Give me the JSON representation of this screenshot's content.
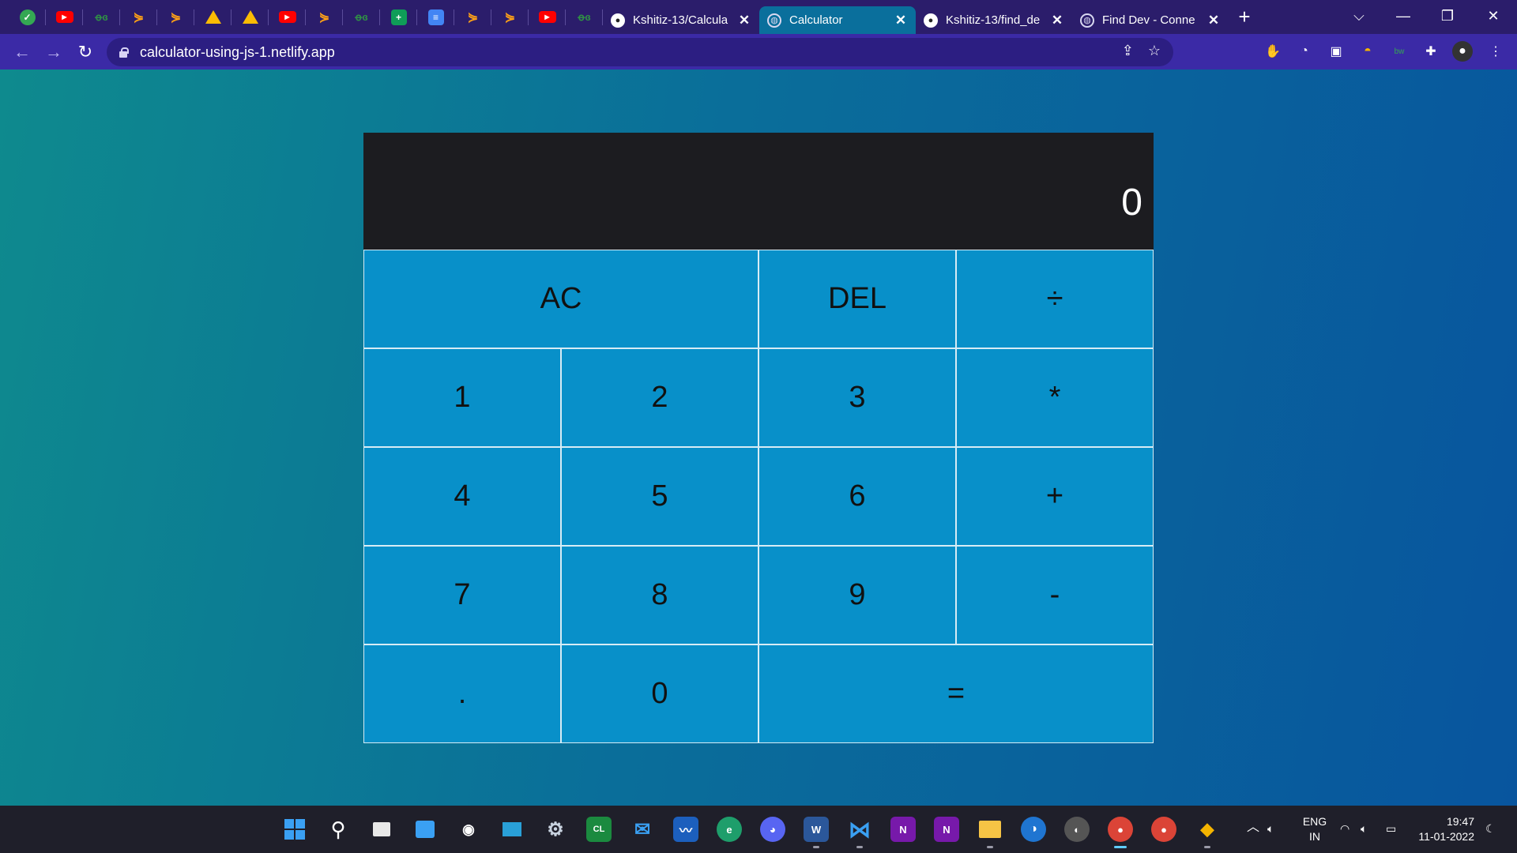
{
  "browser": {
    "pinned_tabs": [
      {
        "icon": "green-check-icon",
        "glyph": "✓",
        "style": "green"
      },
      {
        "icon": "youtube-icon",
        "glyph": "▶",
        "style": "yt"
      },
      {
        "icon": "geeksforgeeks-icon",
        "glyph": "ꝋɞ",
        "style": "gfg"
      },
      {
        "icon": "leetcode-icon",
        "glyph": "⋟",
        "style": "leet"
      },
      {
        "icon": "leetcode-icon",
        "glyph": "⋟",
        "style": "leet"
      },
      {
        "icon": "google-drive-icon",
        "glyph": "",
        "style": "drive"
      },
      {
        "icon": "google-drive-icon",
        "glyph": "",
        "style": "drive"
      },
      {
        "icon": "youtube-icon",
        "glyph": "▶",
        "style": "yt"
      },
      {
        "icon": "leetcode-icon",
        "glyph": "⋟",
        "style": "leet"
      },
      {
        "icon": "geeksforgeeks-icon",
        "glyph": "ꝋɞ",
        "style": "gfg"
      },
      {
        "icon": "google-sheets-icon",
        "glyph": "+",
        "style": "sheets"
      },
      {
        "icon": "google-docs-icon",
        "glyph": "≡",
        "style": "docs"
      },
      {
        "icon": "leetcode-icon",
        "glyph": "⋟",
        "style": "leet"
      },
      {
        "icon": "leetcode-icon",
        "glyph": "⋟",
        "style": "leet"
      },
      {
        "icon": "youtube-icon",
        "glyph": "▶",
        "style": "yt"
      },
      {
        "icon": "geeksforgeeks-icon",
        "glyph": "ꝋɞ",
        "style": "gfg"
      }
    ],
    "tabs": [
      {
        "title": "Kshitiz-13/Calcula",
        "icon": "github-icon",
        "active": false
      },
      {
        "title": "Calculator",
        "icon": "globe-icon",
        "active": true
      },
      {
        "title": "Kshitiz-13/find_de",
        "icon": "github-icon",
        "active": false
      },
      {
        "title": "Find Dev - Conne",
        "icon": "globe-icon",
        "active": false
      }
    ],
    "new_tab_label": "+",
    "url": "calculator-using-js-1.netlify.app"
  },
  "calculator": {
    "display_value": "0",
    "keys": [
      {
        "label": "AC",
        "name": "all-clear-button",
        "span": 2
      },
      {
        "label": "DEL",
        "name": "delete-button",
        "span": 1
      },
      {
        "label": "÷",
        "name": "divide-button",
        "span": 1
      },
      {
        "label": "1",
        "name": "digit-1-button",
        "span": 1
      },
      {
        "label": "2",
        "name": "digit-2-button",
        "span": 1
      },
      {
        "label": "3",
        "name": "digit-3-button",
        "span": 1
      },
      {
        "label": "*",
        "name": "multiply-button",
        "span": 1
      },
      {
        "label": "4",
        "name": "digit-4-button",
        "span": 1
      },
      {
        "label": "5",
        "name": "digit-5-button",
        "span": 1
      },
      {
        "label": "6",
        "name": "digit-6-button",
        "span": 1
      },
      {
        "label": "+",
        "name": "add-button",
        "span": 1
      },
      {
        "label": "7",
        "name": "digit-7-button",
        "span": 1
      },
      {
        "label": "8",
        "name": "digit-8-button",
        "span": 1
      },
      {
        "label": "9",
        "name": "digit-9-button",
        "span": 1
      },
      {
        "label": "-",
        "name": "subtract-button",
        "span": 1
      },
      {
        "label": ".",
        "name": "decimal-button",
        "span": 1
      },
      {
        "label": "0",
        "name": "digit-0-button",
        "span": 1
      },
      {
        "label": "=",
        "name": "equals-button",
        "span": 2
      }
    ]
  },
  "taskbar": {
    "language": "ENG",
    "region": "IN",
    "time": "19:47",
    "date": "11-01-2022"
  },
  "colors": {
    "tab_strip": "#2b1d6b",
    "toolbar": "#3b2aa6",
    "key_background": "#0890c9",
    "display_background": "#1c1c20"
  }
}
